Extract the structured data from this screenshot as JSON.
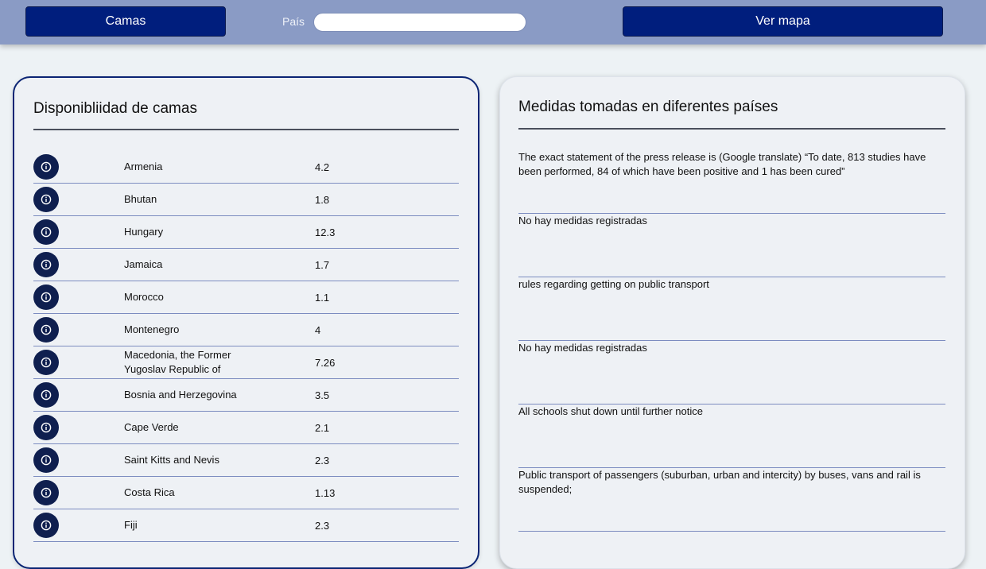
{
  "topbar": {
    "camas_label": "Camas",
    "pais_label": "País",
    "pais_value": "",
    "mapa_label": "Ver mapa"
  },
  "beds": {
    "title": "Disponibliidad de camas",
    "rows": [
      {
        "country": "Armenia",
        "value": "4.2"
      },
      {
        "country": "Bhutan",
        "value": "1.8"
      },
      {
        "country": "Hungary",
        "value": "12.3"
      },
      {
        "country": "Jamaica",
        "value": "1.7"
      },
      {
        "country": "Morocco",
        "value": "1.1"
      },
      {
        "country": "Montenegro",
        "value": "4"
      },
      {
        "country": "Macedonia, the Former Yugoslav Republic of",
        "value": "7.26"
      },
      {
        "country": "Bosnia and Herzegovina",
        "value": "3.5"
      },
      {
        "country": "Cape Verde",
        "value": "2.1"
      },
      {
        "country": "Saint Kitts and Nevis",
        "value": "2.3"
      },
      {
        "country": "Costa Rica",
        "value": "1.13"
      },
      {
        "country": "Fiji",
        "value": "2.3"
      }
    ]
  },
  "measures": {
    "title": "Medidas tomadas en diferentes países",
    "items": [
      "The exact statement of the press release is (Google translate) “To date, 813 studies have been performed, 84 of which have been positive and 1 has been cured”",
      "No hay medidas registradas",
      "rules regarding getting on public transport",
      "No hay medidas registradas",
      "All schools shut down until further notice",
      "Public transport of passengers (suburban, urban and intercity) by buses, vans and rail is suspended;"
    ]
  },
  "icons": {
    "row_icon": "info-icon"
  },
  "colors": {
    "topbar": "#8a9bc5",
    "button": "#001e7d",
    "icon_bg": "#0f1f4f",
    "row_divider": "#7c8cc0",
    "card_border": "#0b2574"
  }
}
